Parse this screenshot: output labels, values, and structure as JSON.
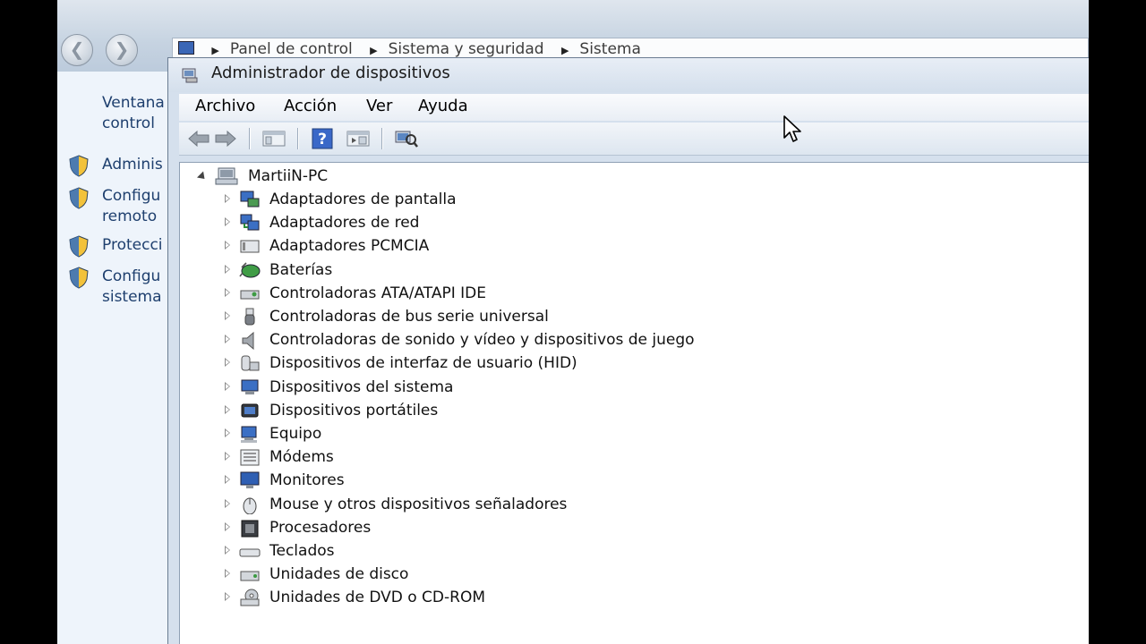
{
  "background_window": {
    "breadcrumb": [
      "Panel de control",
      "Sistema y seguridad",
      "Sistema"
    ],
    "left_links": [
      {
        "line1": "Ventana",
        "line2": "control",
        "shield": false
      },
      {
        "line1": "Adminis",
        "line2": "",
        "shield": true
      },
      {
        "line1": "Configu",
        "line2": "remoto",
        "shield": true
      },
      {
        "line1": "Protecci",
        "line2": "",
        "shield": true
      },
      {
        "line1": "Configu",
        "line2": "sistema",
        "shield": true
      }
    ]
  },
  "device_manager": {
    "title": "Administrador de dispositivos",
    "menu": [
      "Archivo",
      "Acción",
      "Ver",
      "Ayuda"
    ],
    "toolbar_icons": [
      "back-arrow-icon",
      "forward-arrow-icon",
      "show-hide-tree-icon",
      "help-icon",
      "properties-icon",
      "scan-hardware-icon"
    ],
    "root": "MartiiN-PC",
    "devices": [
      {
        "label": "Adaptadores de pantalla",
        "icon": "display-adapter-icon"
      },
      {
        "label": "Adaptadores de red",
        "icon": "network-adapter-icon"
      },
      {
        "label": "Adaptadores PCMCIA",
        "icon": "pcmcia-icon"
      },
      {
        "label": "Baterías",
        "icon": "battery-icon"
      },
      {
        "label": "Controladoras ATA/ATAPI IDE",
        "icon": "ide-controller-icon"
      },
      {
        "label": "Controladoras de bus serie universal",
        "icon": "usb-icon"
      },
      {
        "label": "Controladoras de sonido y vídeo y dispositivos de juego",
        "icon": "speaker-icon"
      },
      {
        "label": "Dispositivos de interfaz de usuario (HID)",
        "icon": "hid-icon"
      },
      {
        "label": "Dispositivos del sistema",
        "icon": "system-device-icon"
      },
      {
        "label": "Dispositivos portátiles",
        "icon": "portable-device-icon"
      },
      {
        "label": "Equipo",
        "icon": "computer-icon"
      },
      {
        "label": "Módems",
        "icon": "modem-icon"
      },
      {
        "label": "Monitores",
        "icon": "monitor-icon"
      },
      {
        "label": "Mouse y otros dispositivos señaladores",
        "icon": "mouse-icon"
      },
      {
        "label": "Procesadores",
        "icon": "processor-icon"
      },
      {
        "label": "Teclados",
        "icon": "keyboard-icon"
      },
      {
        "label": "Unidades de disco",
        "icon": "disk-drive-icon"
      },
      {
        "label": "Unidades de DVD o CD-ROM",
        "icon": "dvd-drive-icon"
      }
    ]
  }
}
